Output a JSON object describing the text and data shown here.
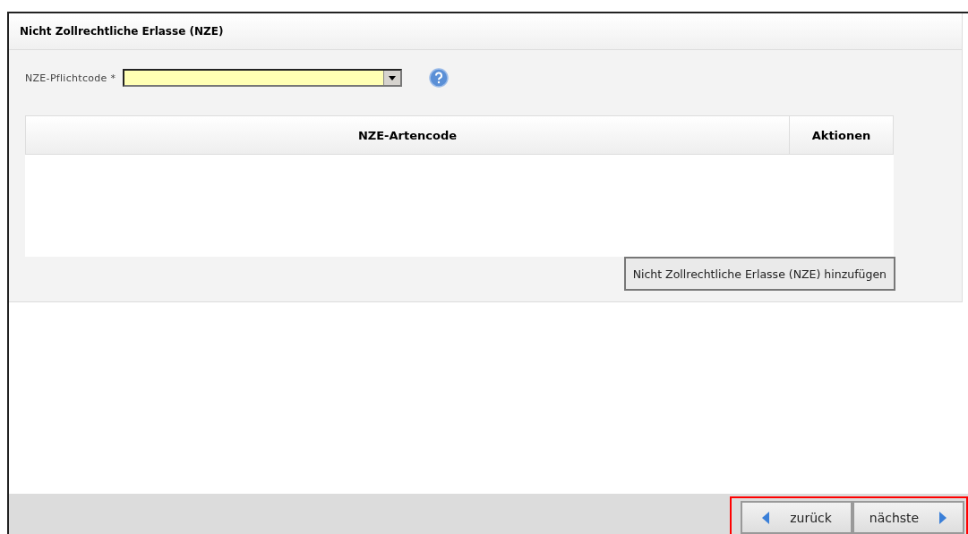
{
  "panel": {
    "title": "Nicht Zollrechtliche Erlasse (NZE)"
  },
  "field": {
    "label": "NZE-Pflichtcode *"
  },
  "table": {
    "columns": [
      "NZE-Artencode",
      "Aktionen"
    ]
  },
  "add_button": "Nicht Zollrechtliche Erlasse (NZE) hinzufügen",
  "nav": [
    {
      "kind": "back",
      "label": "zurück"
    },
    {
      "kind": "next",
      "label": "nächste"
    }
  ]
}
